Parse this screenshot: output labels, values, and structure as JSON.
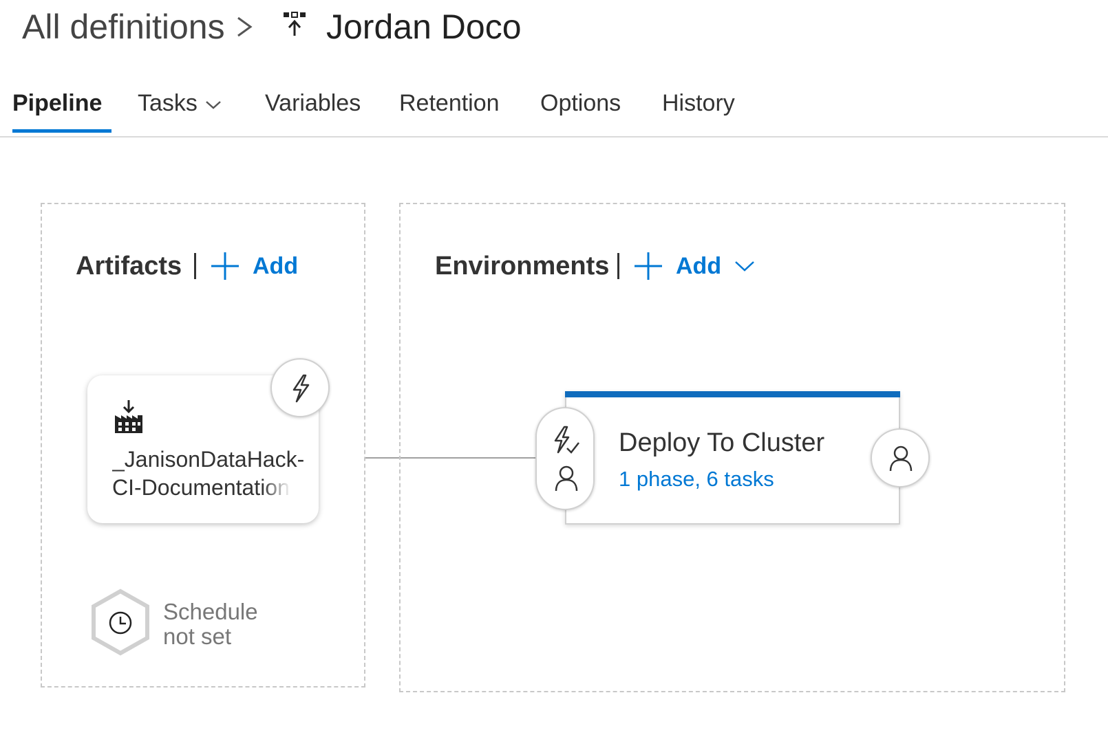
{
  "breadcrumb": {
    "root": "All definitions",
    "title": "Jordan Doco",
    "separator_icon": "chevron-right-icon",
    "definition_icon": "release-pipeline-icon"
  },
  "tabs": [
    {
      "label": "Pipeline",
      "active": true
    },
    {
      "label": "Tasks",
      "has_dropdown": true
    },
    {
      "label": "Variables"
    },
    {
      "label": "Retention"
    },
    {
      "label": "Options"
    },
    {
      "label": "History"
    }
  ],
  "artifacts": {
    "title": "Artifacts",
    "add_label": "Add",
    "item": {
      "name_line1": "_JanisonDataHack-",
      "name_line2": "CI-Documentation",
      "icon": "build-artifact-icon",
      "trigger_icon": "lightning-icon"
    },
    "schedule": {
      "line1": "Schedule",
      "line2": "not set",
      "icon": "clock-icon"
    }
  },
  "environments": {
    "title": "Environments",
    "add_label": "Add",
    "item": {
      "name": "Deploy To Cluster",
      "summary": "1 phase, 6 tasks",
      "pre_deploy_icons": [
        "pre-deployment-conditions-icon",
        "pre-deployment-approvers-icon"
      ],
      "post_deploy_icon": "post-deployment-approvers-icon"
    }
  },
  "colors": {
    "accent": "#0078d4",
    "environment_bar": "#0f6cbd"
  }
}
